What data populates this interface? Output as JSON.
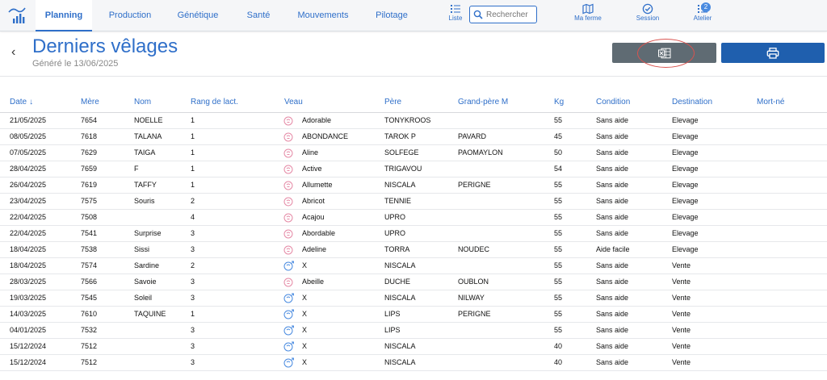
{
  "nav": {
    "tabs": [
      {
        "label": "Planning",
        "active": true
      },
      {
        "label": "Production",
        "active": false
      },
      {
        "label": "Génétique",
        "active": false
      },
      {
        "label": "Santé",
        "active": false
      },
      {
        "label": "Mouvements",
        "active": false
      },
      {
        "label": "Pilotage",
        "active": false
      }
    ],
    "liste_label": "Liste",
    "search_placeholder": "Rechercher",
    "ma_ferme_label": "Ma ferme",
    "session_label": "Session",
    "atelier_label": "Atelier",
    "atelier_badge": "2"
  },
  "header": {
    "title": "Derniers vêlages",
    "subtitle": "Généré le 13/06/2025",
    "back_glyph": "‹"
  },
  "colors": {
    "accent": "#2f6fc9",
    "excel_button": "#5f6b73",
    "print_button": "#1f5fae",
    "female_icon": "#e58aa6",
    "male_icon": "#4a8be0"
  },
  "table": {
    "columns": [
      "Date",
      "Mère",
      "Nom",
      "Rang de lact.",
      "Veau",
      "Père",
      "Grand-père M",
      "Kg",
      "Condition",
      "Destination",
      "Mort-né"
    ],
    "sort_column": "Date",
    "sort_glyph": "↓",
    "rows": [
      {
        "date": "21/05/2025",
        "mere": "7654",
        "nom": "NOELLE",
        "rang": "1",
        "sex": "F",
        "veau": "Adorable",
        "pere": "TONYKROOS",
        "gp": "",
        "kg": "55",
        "condition": "Sans aide",
        "destination": "Elevage",
        "mort": ""
      },
      {
        "date": "08/05/2025",
        "mere": "7618",
        "nom": "TALANA",
        "rang": "1",
        "sex": "F",
        "veau": "ABONDANCE",
        "pere": "TAROK P",
        "gp": "PAVARD",
        "kg": "45",
        "condition": "Sans aide",
        "destination": "Elevage",
        "mort": ""
      },
      {
        "date": "07/05/2025",
        "mere": "7629",
        "nom": "TAIGA",
        "rang": "1",
        "sex": "F",
        "veau": "Aline",
        "pere": "SOLFEGE",
        "gp": "PAOMAYLON",
        "kg": "50",
        "condition": "Sans aide",
        "destination": "Elevage",
        "mort": ""
      },
      {
        "date": "28/04/2025",
        "mere": "7659",
        "nom": "F",
        "rang": "1",
        "sex": "F",
        "veau": "Active",
        "pere": "TRIGAVOU",
        "gp": "",
        "kg": "54",
        "condition": "Sans aide",
        "destination": "Elevage",
        "mort": ""
      },
      {
        "date": "26/04/2025",
        "mere": "7619",
        "nom": "TAFFY",
        "rang": "1",
        "sex": "F",
        "veau": "Allumette",
        "pere": "NISCALA",
        "gp": "PERIGNE",
        "kg": "55",
        "condition": "Sans aide",
        "destination": "Elevage",
        "mort": ""
      },
      {
        "date": "23/04/2025",
        "mere": "7575",
        "nom": "Souris",
        "rang": "2",
        "sex": "F",
        "veau": "Abricot",
        "pere": "TENNIE",
        "gp": "",
        "kg": "55",
        "condition": "Sans aide",
        "destination": "Elevage",
        "mort": ""
      },
      {
        "date": "22/04/2025",
        "mere": "7508",
        "nom": "",
        "rang": "4",
        "sex": "F",
        "veau": "Acajou",
        "pere": "UPRO",
        "gp": "",
        "kg": "55",
        "condition": "Sans aide",
        "destination": "Elevage",
        "mort": ""
      },
      {
        "date": "22/04/2025",
        "mere": "7541",
        "nom": "Surprise",
        "rang": "3",
        "sex": "F",
        "veau": "Abordable",
        "pere": "UPRO",
        "gp": "",
        "kg": "55",
        "condition": "Sans aide",
        "destination": "Elevage",
        "mort": ""
      },
      {
        "date": "18/04/2025",
        "mere": "7538",
        "nom": "Sissi",
        "rang": "3",
        "sex": "F",
        "veau": "Adeline",
        "pere": "TORRA",
        "gp": "NOUDEC",
        "kg": "55",
        "condition": "Aide facile",
        "destination": "Elevage",
        "mort": ""
      },
      {
        "date": "18/04/2025",
        "mere": "7574",
        "nom": "Sardine",
        "rang": "2",
        "sex": "M",
        "veau": "X",
        "pere": "NISCALA",
        "gp": "",
        "kg": "55",
        "condition": "Sans aide",
        "destination": "Vente",
        "mort": ""
      },
      {
        "date": "28/03/2025",
        "mere": "7566",
        "nom": "Savoie",
        "rang": "3",
        "sex": "F",
        "veau": "Abeille",
        "pere": "DUCHE",
        "gp": "OUBLON",
        "kg": "55",
        "condition": "Sans aide",
        "destination": "Vente",
        "mort": ""
      },
      {
        "date": "19/03/2025",
        "mere": "7545",
        "nom": "Soleil",
        "rang": "3",
        "sex": "M",
        "veau": "X",
        "pere": "NISCALA",
        "gp": "NILWAY",
        "kg": "55",
        "condition": "Sans aide",
        "destination": "Vente",
        "mort": ""
      },
      {
        "date": "14/03/2025",
        "mere": "7610",
        "nom": "TAQUINE",
        "rang": "1",
        "sex": "M",
        "veau": "X",
        "pere": "LIPS",
        "gp": "PERIGNE",
        "kg": "55",
        "condition": "Sans aide",
        "destination": "Vente",
        "mort": ""
      },
      {
        "date": "04/01/2025",
        "mere": "7532",
        "nom": "",
        "rang": "3",
        "sex": "M",
        "veau": "X",
        "pere": "LIPS",
        "gp": "",
        "kg": "55",
        "condition": "Sans aide",
        "destination": "Vente",
        "mort": ""
      },
      {
        "date": "15/12/2024",
        "mere": "7512",
        "nom": "",
        "rang": "3",
        "sex": "M",
        "veau": "X",
        "pere": "NISCALA",
        "gp": "",
        "kg": "40",
        "condition": "Sans aide",
        "destination": "Vente",
        "mort": ""
      },
      {
        "date": "15/12/2024",
        "mere": "7512",
        "nom": "",
        "rang": "3",
        "sex": "M",
        "veau": "X",
        "pere": "NISCALA",
        "gp": "",
        "kg": "40",
        "condition": "Sans aide",
        "destination": "Vente",
        "mort": ""
      }
    ]
  }
}
